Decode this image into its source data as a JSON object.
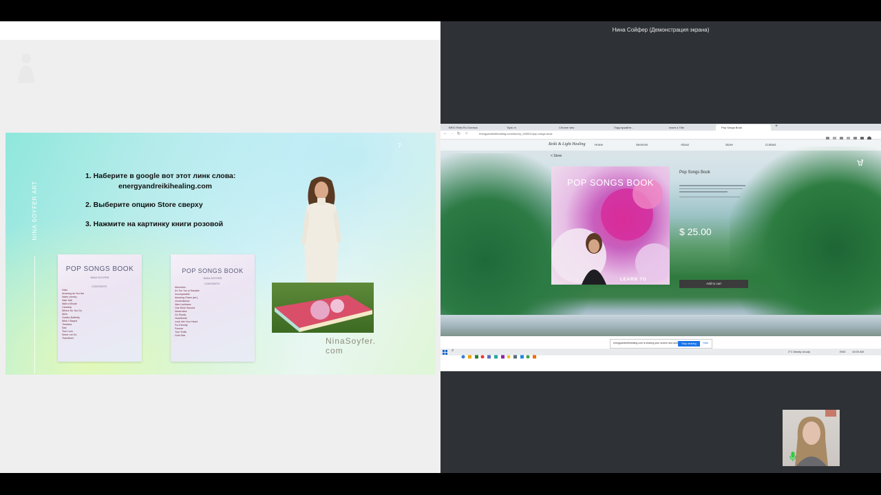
{
  "screen_share": {
    "label": "Нина Сойфер (Демонстрация экрана)"
  },
  "left_slide": {
    "vertical_label": "NINA SOYFER ART",
    "instructions": [
      "1.  Наберите в google вот этот линк слова:",
      "energyandreikihealing.com",
      "2. Выберите опцию Store сверху",
      "3. Нажмите на картинку  книги розовой"
    ],
    "book_cover_1": {
      "title": "POP SONGS BOOK",
      "subtitle": "NINA SOYFER",
      "contents_header": "CONTENTS",
      "songs": [
        "Hello",
        "Amazing as You Are",
        "Water (remix)",
        "Safe Salt",
        "Wait a Minute",
        "Careless",
        "Where Do You Go",
        "Alien",
        "Golden Butterfly",
        "Wish I Stayed",
        "Timeless",
        "Sad",
        "True Love",
        "Never Let Go",
        "Transfixed"
      ]
    },
    "book_cover_2": {
      "title": "POP SONGS BOOK",
      "subtitle": "NINA SOYFER",
      "contents_header": "CONTENTS",
      "songs": [
        "Memories",
        "It's Too You to Breathe",
        "Incomparable",
        "Amazing Grace (arr.)",
        "Unmentioned",
        "Nice Lonliness",
        "One More Second",
        "Nevermind",
        "Go Slowly",
        "Heartbreak",
        "Look Into Your Heart",
        "For Eternity",
        "Forever",
        "Your Smile",
        "Gold Star"
      ]
    },
    "signature": {
      "line1": "NinaSoyfer.",
      "line2": "com"
    }
  },
  "browser": {
    "tabs": [
      "BRIO Reiki Ru Осенью",
      "Topic m",
      "Chrome wtw",
      "Подслушайте...",
      "Insert a Title",
      "Pop Songs Book"
    ],
    "url": "energyandreikihealing.com/store/p_000001/pop-songs-book",
    "site": {
      "logo": "Reiki & Light Healing",
      "nav": [
        "Home",
        "Services",
        "About",
        "Store",
        "Contact"
      ],
      "back_link": "< Store",
      "product_image_title": "POP SONGS BOOK",
      "product_image_caption": "LEARN TO",
      "product_title": "Pop Songs Book",
      "price": "$ 25.00",
      "add_to_cart": "Add to cart"
    },
    "share_notice": {
      "text": "energyandreikihealing.com is sharing your screen and audio.",
      "stop_label": "Stop sharing",
      "hide_label": "Hide"
    },
    "taskbar": {
      "weather": "2°C  Mostly cloudy",
      "lang": "ENG",
      "time": "10:00 AM"
    }
  },
  "colors": {
    "meeting_bg": "#2e3135",
    "slide_teal": "#8fe7dc",
    "stop_btn": "#1a73e8",
    "mic_active": "#2ecc40"
  }
}
